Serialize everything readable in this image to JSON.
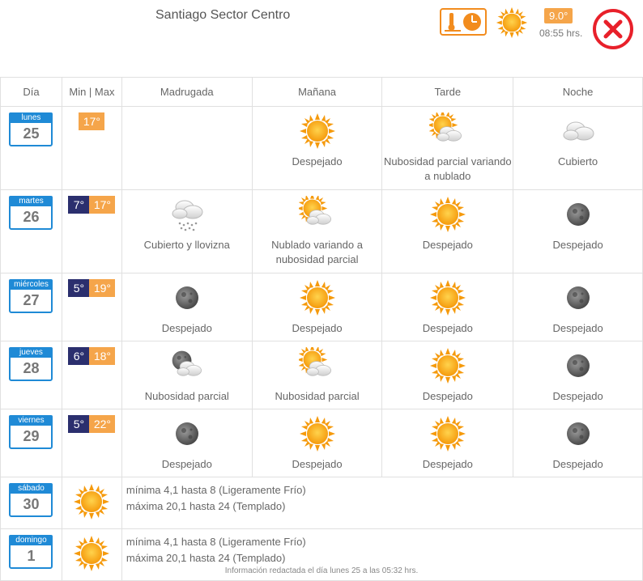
{
  "header": {
    "title": "Santiago Sector Centro",
    "current_temp": "9.0°",
    "current_time": "08:55 hrs."
  },
  "columns": {
    "day": "Día",
    "minmax": "Min | Max",
    "madrugada": "Madrugada",
    "manana": "Mañana",
    "tarde": "Tarde",
    "noche": "Noche"
  },
  "days": [
    {
      "name": "lunes",
      "num": "25",
      "min": "",
      "max": "17°",
      "madrugada": {
        "icon": "",
        "label": ""
      },
      "manana": {
        "icon": "sun",
        "label": "Despejado"
      },
      "tarde": {
        "icon": "sun-cloud",
        "label": "Nubosidad parcial variando a nublado"
      },
      "noche": {
        "icon": "cloud",
        "label": "Cubierto"
      }
    },
    {
      "name": "martes",
      "num": "26",
      "min": "7°",
      "max": "17°",
      "madrugada": {
        "icon": "drizzle",
        "label": "Cubierto y llovizna"
      },
      "manana": {
        "icon": "sun-cloud",
        "label": "Nublado variando a nubosidad parcial"
      },
      "tarde": {
        "icon": "sun",
        "label": "Despejado"
      },
      "noche": {
        "icon": "moon",
        "label": "Despejado"
      }
    },
    {
      "name": "miércoles",
      "num": "27",
      "min": "5°",
      "max": "19°",
      "madrugada": {
        "icon": "moon",
        "label": "Despejado"
      },
      "manana": {
        "icon": "sun",
        "label": "Despejado"
      },
      "tarde": {
        "icon": "sun",
        "label": "Despejado"
      },
      "noche": {
        "icon": "moon",
        "label": "Despejado"
      }
    },
    {
      "name": "jueves",
      "num": "28",
      "min": "6°",
      "max": "18°",
      "madrugada": {
        "icon": "moon-cloud",
        "label": "Nubosidad parcial"
      },
      "manana": {
        "icon": "sun-cloud",
        "label": "Nubosidad parcial"
      },
      "tarde": {
        "icon": "sun",
        "label": "Despejado"
      },
      "noche": {
        "icon": "moon",
        "label": "Despejado"
      }
    },
    {
      "name": "viernes",
      "num": "29",
      "min": "5°",
      "max": "22°",
      "madrugada": {
        "icon": "moon",
        "label": "Despejado"
      },
      "manana": {
        "icon": "sun",
        "label": "Despejado"
      },
      "tarde": {
        "icon": "sun",
        "label": "Despejado"
      },
      "noche": {
        "icon": "moon",
        "label": "Despejado"
      }
    }
  ],
  "summary_days": [
    {
      "name": "sábado",
      "num": "30",
      "line1": "mínima 4,1 hasta 8 (Ligeramente Frío)",
      "line2": "máxima 20,1 hasta 24 (Templado)"
    },
    {
      "name": "domingo",
      "num": "1",
      "line1": "mínima 4,1 hasta 8 (Ligeramente Frío)",
      "line2": "máxima 20,1 hasta 24 (Templado)"
    }
  ],
  "footer": "Información redactada el día lunes 25 a las 05:32 hrs."
}
